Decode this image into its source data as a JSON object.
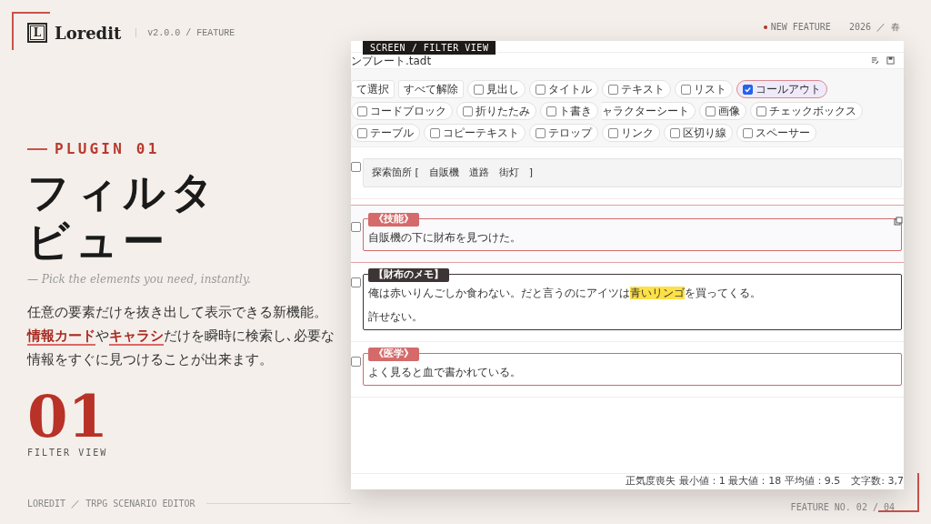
{
  "header": {
    "logo_letter": "L",
    "brand": "Loredit",
    "version": "v2.0.0 / FEATURE",
    "tag": "NEW FEATURE",
    "date": "2026 ／ 春"
  },
  "hero": {
    "eyebrow": "PLUGIN 01",
    "title_lines": [
      "フィルタ",
      "ビュー"
    ],
    "subtitle": "— Pick the elements you need, instantly.",
    "description": [
      [
        {
          "text": "任意の要素だけを抜き出して表示できる新機能。",
          "kind": "plain"
        }
      ],
      [
        {
          "text": "情報カード",
          "kind": "highlight"
        },
        {
          "text": "や",
          "kind": "plain"
        },
        {
          "text": "キャラシ",
          "kind": "highlight"
        },
        {
          "text": "だけを瞬時に検索し､必要な情報をすぐに見つけることが出来ます。",
          "kind": "plain"
        }
      ]
    ],
    "number": "01",
    "number_caption": "FILTER VIEW"
  },
  "footer": {
    "left": "LOREDIT ／ TRPG SCENARIO EDITOR",
    "right": "FEATURE NO. 02 / 04"
  },
  "window": {
    "badge": "SCREEN / FILTER VIEW",
    "filename": "ンプレート.tadt",
    "actions": [
      "て選択",
      "すべて解除"
    ],
    "filters": [
      {
        "label": "見出し",
        "checked": false
      },
      {
        "label": "タイトル",
        "checked": false
      },
      {
        "label": "テキスト",
        "checked": false
      },
      {
        "label": "リスト",
        "checked": false
      },
      {
        "label": "コールアウト",
        "checked": true
      },
      {
        "label": "コードブロック",
        "checked": false
      },
      {
        "label": "折りたたみ",
        "checked": false
      },
      {
        "label": "ト書き",
        "checked": false
      },
      {
        "label": "ャラクターシート"
      },
      {
        "label": "画像",
        "checked": false
      },
      {
        "label": "チェックボックス",
        "checked": false
      },
      {
        "label": "テーブル",
        "checked": false
      },
      {
        "label": "コピーテキスト",
        "checked": false
      },
      {
        "label": "テロップ",
        "checked": false
      },
      {
        "label": "リンク",
        "checked": false
      },
      {
        "label": "区切り線",
        "checked": false
      },
      {
        "label": "スペーサー",
        "checked": false
      }
    ],
    "blocks": [
      {
        "kind": "plain",
        "checked": false,
        "selected": false,
        "text": "探索箇所 [　自販機　道路　街灯　]"
      },
      {
        "kind": "card",
        "checked": false,
        "selected": true,
        "tag": "《技能》",
        "color": "#d46a6a",
        "lines": [
          [
            {
              "text": "自販機の下に財布を見つけた。",
              "mark": false
            }
          ]
        ]
      },
      {
        "kind": "card",
        "checked": false,
        "selected": false,
        "tag": "【財布のメモ】",
        "color": "#3d3535",
        "lines": [
          [
            {
              "text": "俺は赤いりんごしか食わない。だと言うのにアイツは",
              "mark": false
            },
            {
              "text": "青いリンゴ",
              "mark": true
            },
            {
              "text": "を買ってくる。",
              "mark": false
            }
          ],
          [
            {
              "text": "許せない。",
              "mark": false
            }
          ]
        ]
      },
      {
        "kind": "card",
        "checked": false,
        "selected": false,
        "tag": "《医学》",
        "color": "#d46a6a",
        "lines": [
          [
            {
              "text": "よく見ると血で書かれている。",
              "mark": false
            }
          ]
        ]
      }
    ],
    "status": [
      "正気度喪失 最小値：1 最大値：18 平均値：9.5",
      "文字数: 3,7"
    ]
  }
}
